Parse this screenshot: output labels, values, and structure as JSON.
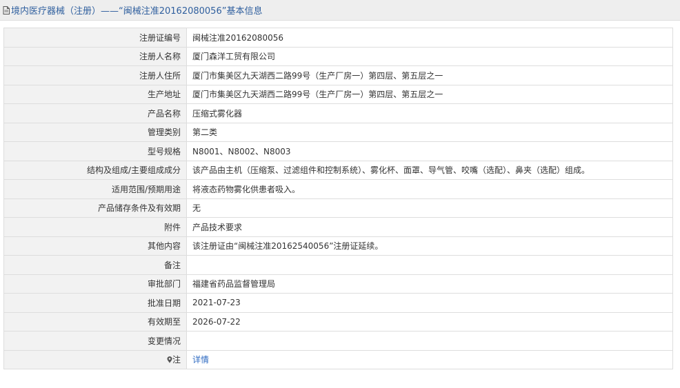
{
  "header": {
    "title": "境内医疗器械（注册）——“闽械注准20162080056”基本信息",
    "icon": "document-icon",
    "color": "#2f5f9e"
  },
  "rows": [
    {
      "label": "注册证编号",
      "value": "闽械注准20162080056"
    },
    {
      "label": "注册人名称",
      "value": "厦门森洋工贸有限公司"
    },
    {
      "label": "注册人住所",
      "value": "厦门市集美区九天湖西二路99号（生产厂房一）第四层、第五层之一"
    },
    {
      "label": "生产地址",
      "value": "厦门市集美区九天湖西二路99号（生产厂房一）第四层、第五层之一"
    },
    {
      "label": "产品名称",
      "value": "压缩式雾化器"
    },
    {
      "label": "管理类别",
      "value": "第二类"
    },
    {
      "label": "型号规格",
      "value": "N8001、N8002、N8003"
    },
    {
      "label": "结构及组成/主要组成成分",
      "value": "该产品由主机（压缩泵、过滤组件和控制系统）、雾化杯、面罩、导气管、咬嘴（选配）、鼻夹（选配）组成。"
    },
    {
      "label": "适用范围/预期用途",
      "value": "将液态药物雾化供患者吸入。"
    },
    {
      "label": "产品储存条件及有效期",
      "value": "无"
    },
    {
      "label": "附件",
      "value": "产品技术要求"
    },
    {
      "label": "其他内容",
      "value": "该注册证由“闽械注准20162540056”注册证延续。"
    },
    {
      "label": "备注",
      "value": ""
    },
    {
      "label": "审批部门",
      "value": "福建省药品监督管理局"
    },
    {
      "label": "批准日期",
      "value": "2021-07-23"
    },
    {
      "label": "有效期至",
      "value": "2026-07-22"
    },
    {
      "label": "变更情况",
      "value": ""
    }
  ],
  "note_row": {
    "label": "注",
    "icon": "pin-icon",
    "link_text": "详情",
    "link_color": "#2f6bc2"
  }
}
